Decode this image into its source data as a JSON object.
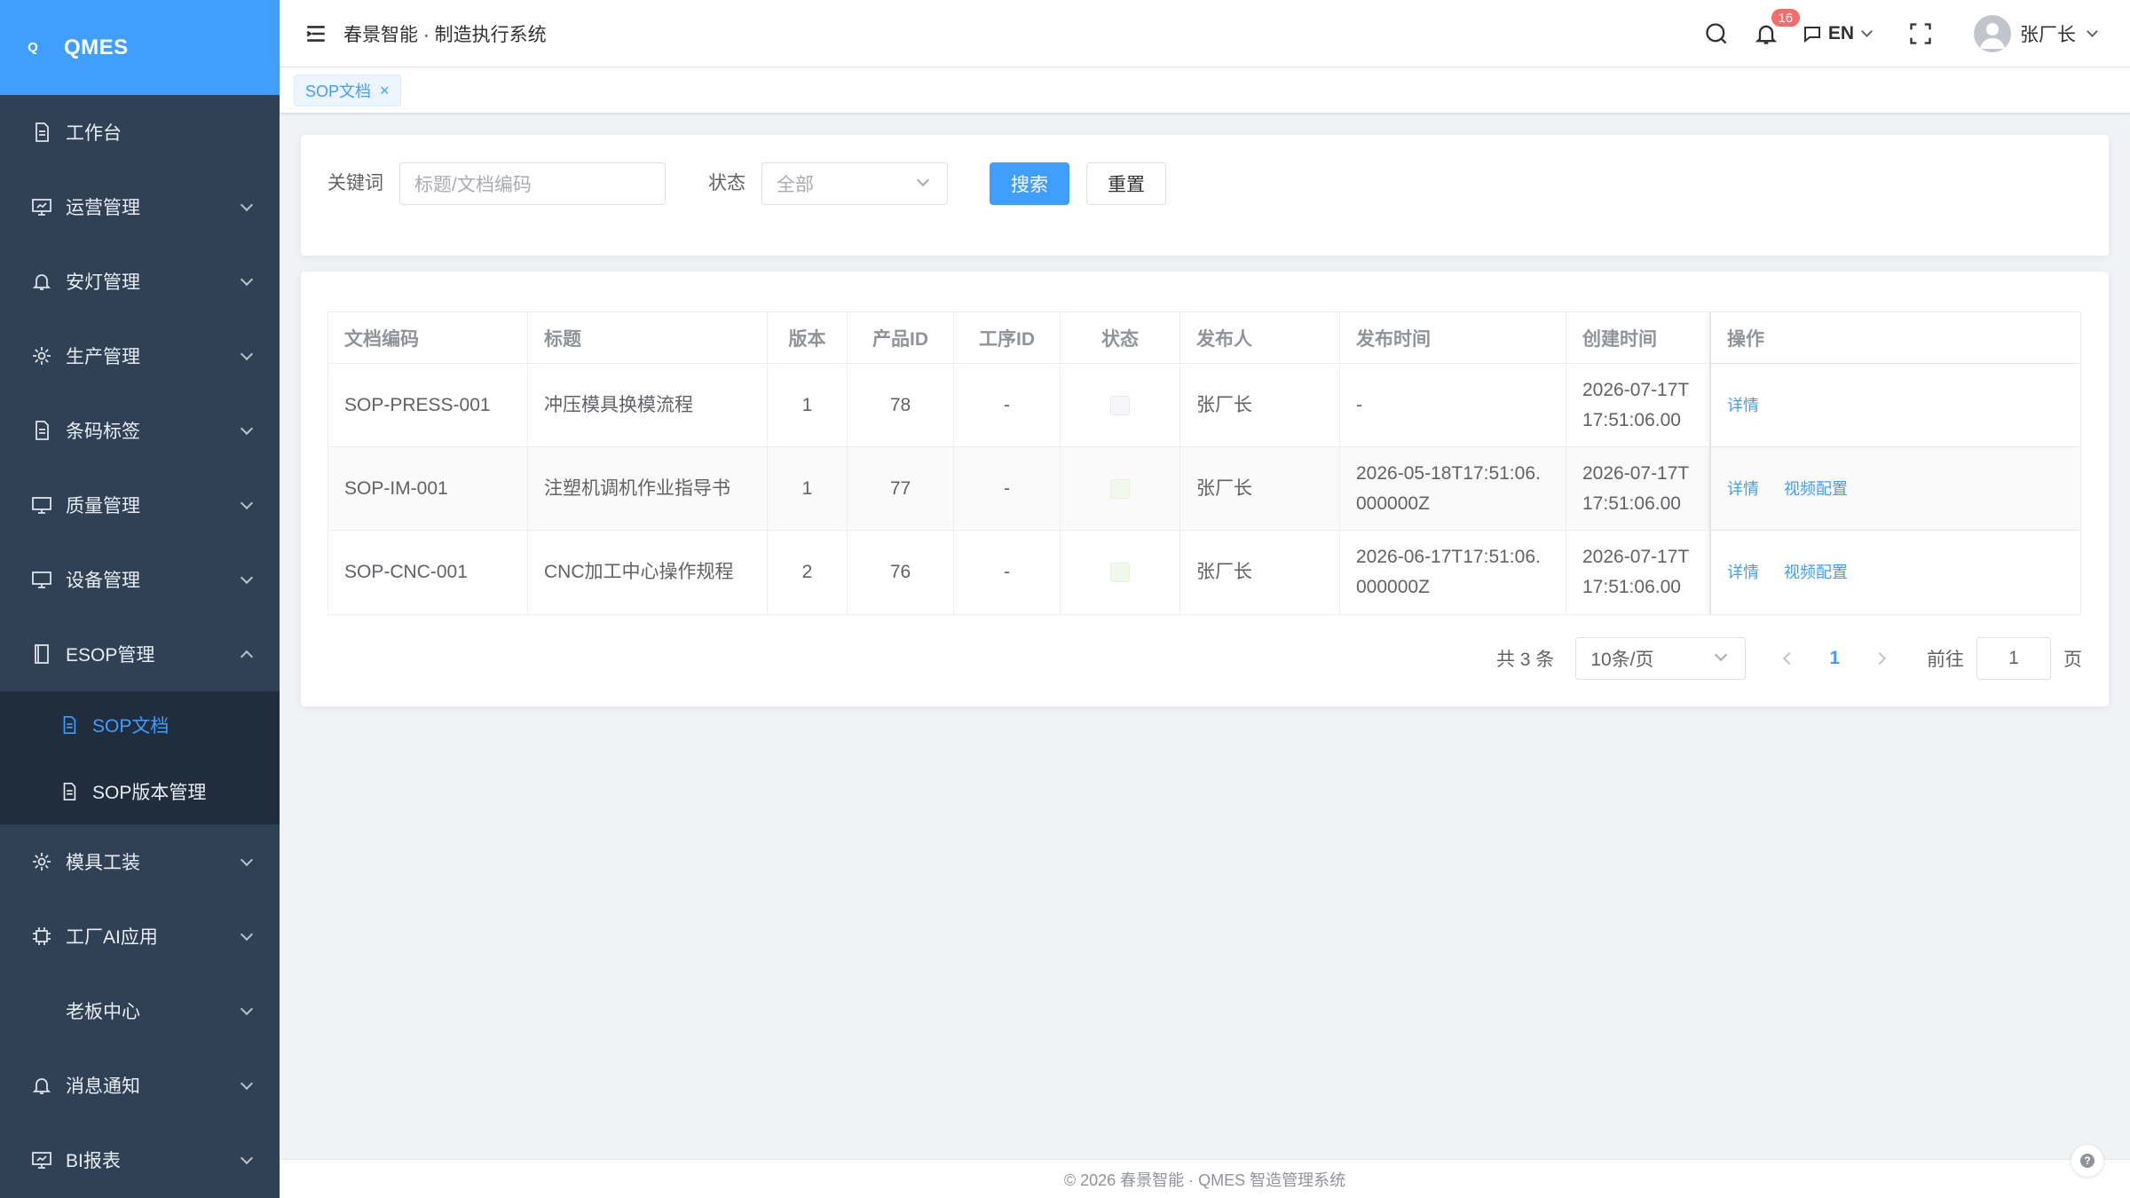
{
  "brand": {
    "mark": "Q",
    "name": "QMES"
  },
  "header": {
    "title": "春景智能 · 制造执行系统",
    "notification_count": "16",
    "language": "EN",
    "user_name": "张厂长"
  },
  "sidebar": {
    "items": [
      {
        "label": "工作台",
        "icon": "document-icon",
        "has_children": false
      },
      {
        "label": "运营管理",
        "icon": "board-icon",
        "has_children": true
      },
      {
        "label": "安灯管理",
        "icon": "bell-icon",
        "has_children": true
      },
      {
        "label": "生产管理",
        "icon": "gear-icon",
        "has_children": true
      },
      {
        "label": "条码标签",
        "icon": "document-icon",
        "has_children": true
      },
      {
        "label": "质量管理",
        "icon": "monitor-icon",
        "has_children": true
      },
      {
        "label": "设备管理",
        "icon": "monitor-icon",
        "has_children": true
      },
      {
        "label": "ESOP管理",
        "icon": "notebook-icon",
        "has_children": true,
        "expanded": true
      }
    ],
    "esop_children": [
      {
        "label": "SOP文档",
        "active": true
      },
      {
        "label": "SOP版本管理",
        "active": false
      }
    ],
    "items_after": [
      {
        "label": "模具工装",
        "icon": "gear-icon"
      },
      {
        "label": "工厂AI应用",
        "icon": "cpu-icon"
      },
      {
        "label": "老板中心",
        "icon": ""
      },
      {
        "label": "消息通知",
        "icon": "bell-icon"
      },
      {
        "label": "BI报表",
        "icon": "board-icon"
      }
    ]
  },
  "tags": [
    {
      "label": "SOP文档",
      "close": "×"
    }
  ],
  "search": {
    "keyword_label": "关键词",
    "keyword_placeholder": "标题/文档编码",
    "status_label": "状态",
    "status_value": "全部",
    "search_button": "搜索",
    "reset_button": "重置"
  },
  "table": {
    "columns": [
      "文档编码",
      "标题",
      "版本",
      "产品ID",
      "工序ID",
      "状态",
      "发布人",
      "发布时间",
      "创建时间",
      "操作"
    ],
    "rows": [
      {
        "code": "SOP-PRESS-001",
        "title": "冲压模具换模流程",
        "version": "1",
        "product_id": "78",
        "process_id": "-",
        "status": "gray",
        "publisher": "张厂长",
        "publish_time": "-",
        "create_time": "2026-07-17T17:51:06.00",
        "actions": [
          "详情"
        ]
      },
      {
        "code": "SOP-IM-001",
        "title": "注塑机调机作业指导书",
        "version": "1",
        "product_id": "77",
        "process_id": "-",
        "status": "green",
        "publisher": "张厂长",
        "publish_time": "2026-05-18T17:51:06.000000Z",
        "create_time": "2026-07-17T17:51:06.00",
        "actions": [
          "详情",
          "视频配置"
        ]
      },
      {
        "code": "SOP-CNC-001",
        "title": "CNC加工中心操作规程",
        "version": "2",
        "product_id": "76",
        "process_id": "-",
        "status": "green",
        "publisher": "张厂长",
        "publish_time": "2026-06-17T17:51:06.000000Z",
        "create_time": "2026-07-17T17:51:06.00",
        "actions": [
          "详情",
          "视频配置"
        ]
      }
    ]
  },
  "pagination": {
    "total_text": "共 3 条",
    "page_size": "10条/页",
    "current_page": "1",
    "goto_label": "前往",
    "goto_value": "1",
    "page_suffix": "页"
  },
  "footer": {
    "text": "© 2026 春景智能 · QMES 智造管理系统"
  },
  "colors": {
    "primary": "#409eff",
    "sidebar": "#304156",
    "sidebar_sub": "#1f2d3d",
    "badge": "#f56c6c"
  }
}
